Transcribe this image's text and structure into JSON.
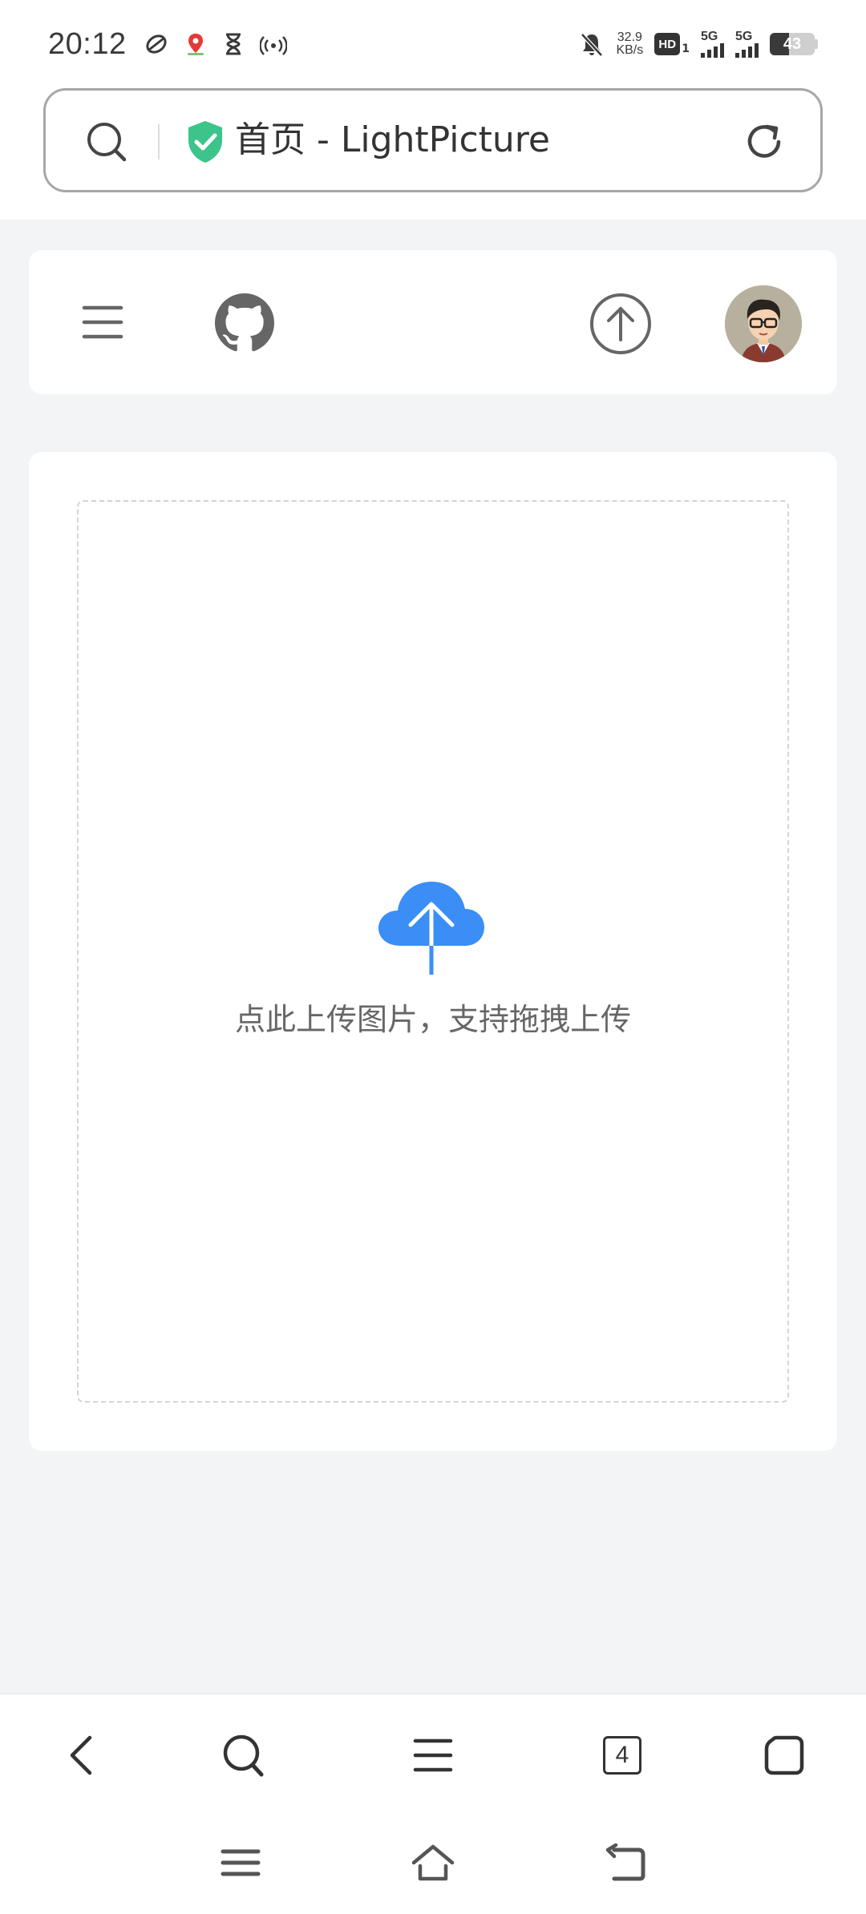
{
  "status_bar": {
    "time": "20:12",
    "speed_value": "32.9",
    "speed_unit": "KB/s",
    "hd_label": "HD",
    "hd_sub": "1",
    "sim1_label": "5G",
    "sim2_label": "5G",
    "battery_percent": "43",
    "battery_level": 0.43
  },
  "address_bar": {
    "title": "首页 - LightPicture"
  },
  "upload": {
    "hint": "点此上传图片，支持拖拽上传"
  },
  "browser_toolbar": {
    "tab_count": "4"
  },
  "colors": {
    "accent": "#3a8ef6",
    "shield": "#3cc48a",
    "page_bg": "#f3f4f6",
    "icon_gray": "#666666"
  }
}
